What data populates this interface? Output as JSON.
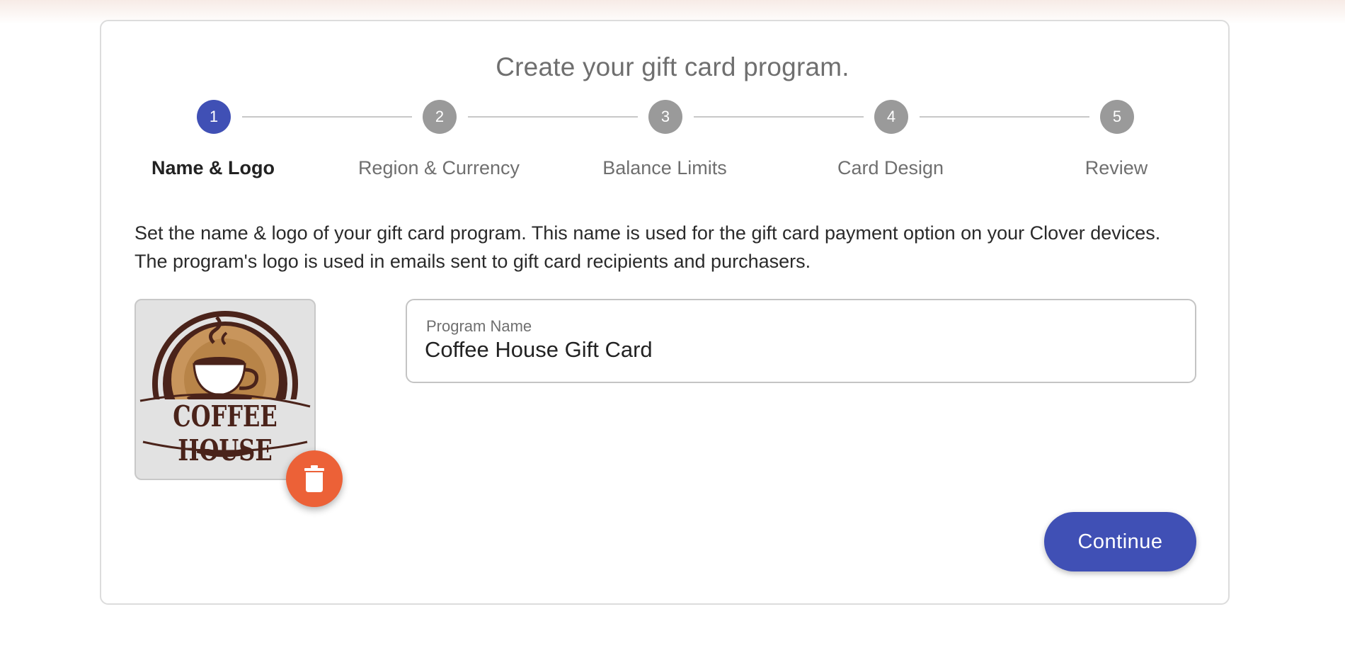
{
  "page": {
    "title": "Create your gift card program."
  },
  "stepper": {
    "steps": [
      {
        "number": "1",
        "label": "Name & Logo",
        "active": true
      },
      {
        "number": "2",
        "label": "Region & Currency",
        "active": false
      },
      {
        "number": "3",
        "label": "Balance Limits",
        "active": false
      },
      {
        "number": "4",
        "label": "Card Design",
        "active": false
      },
      {
        "number": "5",
        "label": "Review",
        "active": false
      }
    ]
  },
  "description": "Set the name & logo of your gift card program. This name is used for the gift card payment option on your Clover devices. The program's logo is used in emails sent to gift card recipients and purchasers.",
  "logo": {
    "text": "COFFEE HOUSE",
    "icon": "coffee-cup-icon",
    "delete_icon": "trash-icon"
  },
  "program_name": {
    "label": "Program Name",
    "value": "Coffee House Gift Card"
  },
  "actions": {
    "continue_label": "Continue"
  },
  "colors": {
    "primary": "#4050b5",
    "inactive_step": "#9a9a9a",
    "delete": "#ec6137"
  }
}
